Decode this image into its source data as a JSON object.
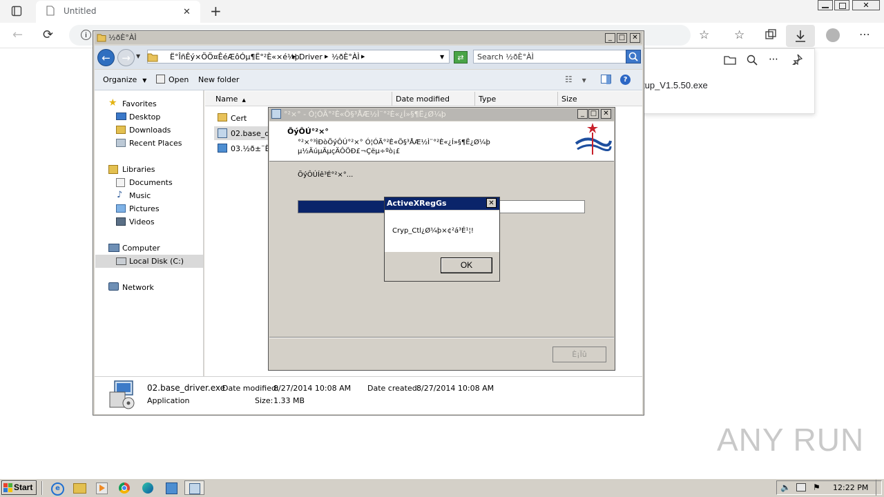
{
  "browser": {
    "tab_title": "Untitled",
    "download_file": "tup_V1.5.50.exe"
  },
  "explorer": {
    "window_title": "½ðÈ°ÀÌ",
    "breadcrumb": [
      "Ë°ÎñÊý×ÖÖ¤ÊéÆôÓµ¶Ë°²È«×é¼þ",
      "Driver",
      "½ðÈ°ÀÌ"
    ],
    "search_placeholder": "Search ½ðÈ°ÀÌ",
    "commands": {
      "organize": "Organize",
      "open": "Open",
      "new_folder": "New folder"
    },
    "nav": {
      "favorites": "Favorites",
      "desktop": "Desktop",
      "downloads": "Downloads",
      "recent": "Recent Places",
      "libraries": "Libraries",
      "documents": "Documents",
      "music": "Music",
      "pictures": "Pictures",
      "videos": "Videos",
      "computer": "Computer",
      "local_disk": "Local Disk (C:)",
      "network": "Network"
    },
    "columns": {
      "name": "Name",
      "date": "Date modified",
      "type": "Type",
      "size": "Size"
    },
    "files": [
      "Cert",
      "02.base_dr",
      "03.½ð±¨Ë"
    ],
    "details": {
      "filename": "02.base_driver.exe",
      "type": "Application",
      "modified_label": "Date modified:",
      "modified_value": "8/27/2014 10:08 AM",
      "created_label": "Date created:",
      "created_value": "8/27/2014 10:08 AM",
      "size_label": "Size:",
      "size_value": "1.33 MB"
    }
  },
  "installer": {
    "title": "°²×° - Ó¦ÓÃ°²È«Ö§³ÅÆ½Ì¨°²È«¿Í»§¶Ë¿Ø¼þ",
    "heading": "ÕýÔÚ°²×°",
    "desc1": "°²×°³ÌÐòÕýÔÚ°²×° Ó¦ÓÃ°²È«Ö§³ÅÆ½Ì¨°²È«¿Í»§¶Ë¿Ø¼þ",
    "desc2": "µ½ÄúµÄµçÄÔÖÐ£¬Çëµ÷ºò¡£",
    "status": "ÕýÔÚÍê³É°²×°...",
    "progress": 0.33,
    "cancel_button": "È¡Ïû"
  },
  "msgbox": {
    "title": "ActiveXRegGs",
    "message": "Cryp_Ctl¿Ø¼þ×¢²á³É¹¦!",
    "ok": "OK"
  },
  "taskbar": {
    "start": "Start",
    "clock": "12:22 PM"
  },
  "watermark": "ANY RUN",
  "colors": {
    "progress": "#0a246a",
    "titlebar": "#0a246a"
  }
}
